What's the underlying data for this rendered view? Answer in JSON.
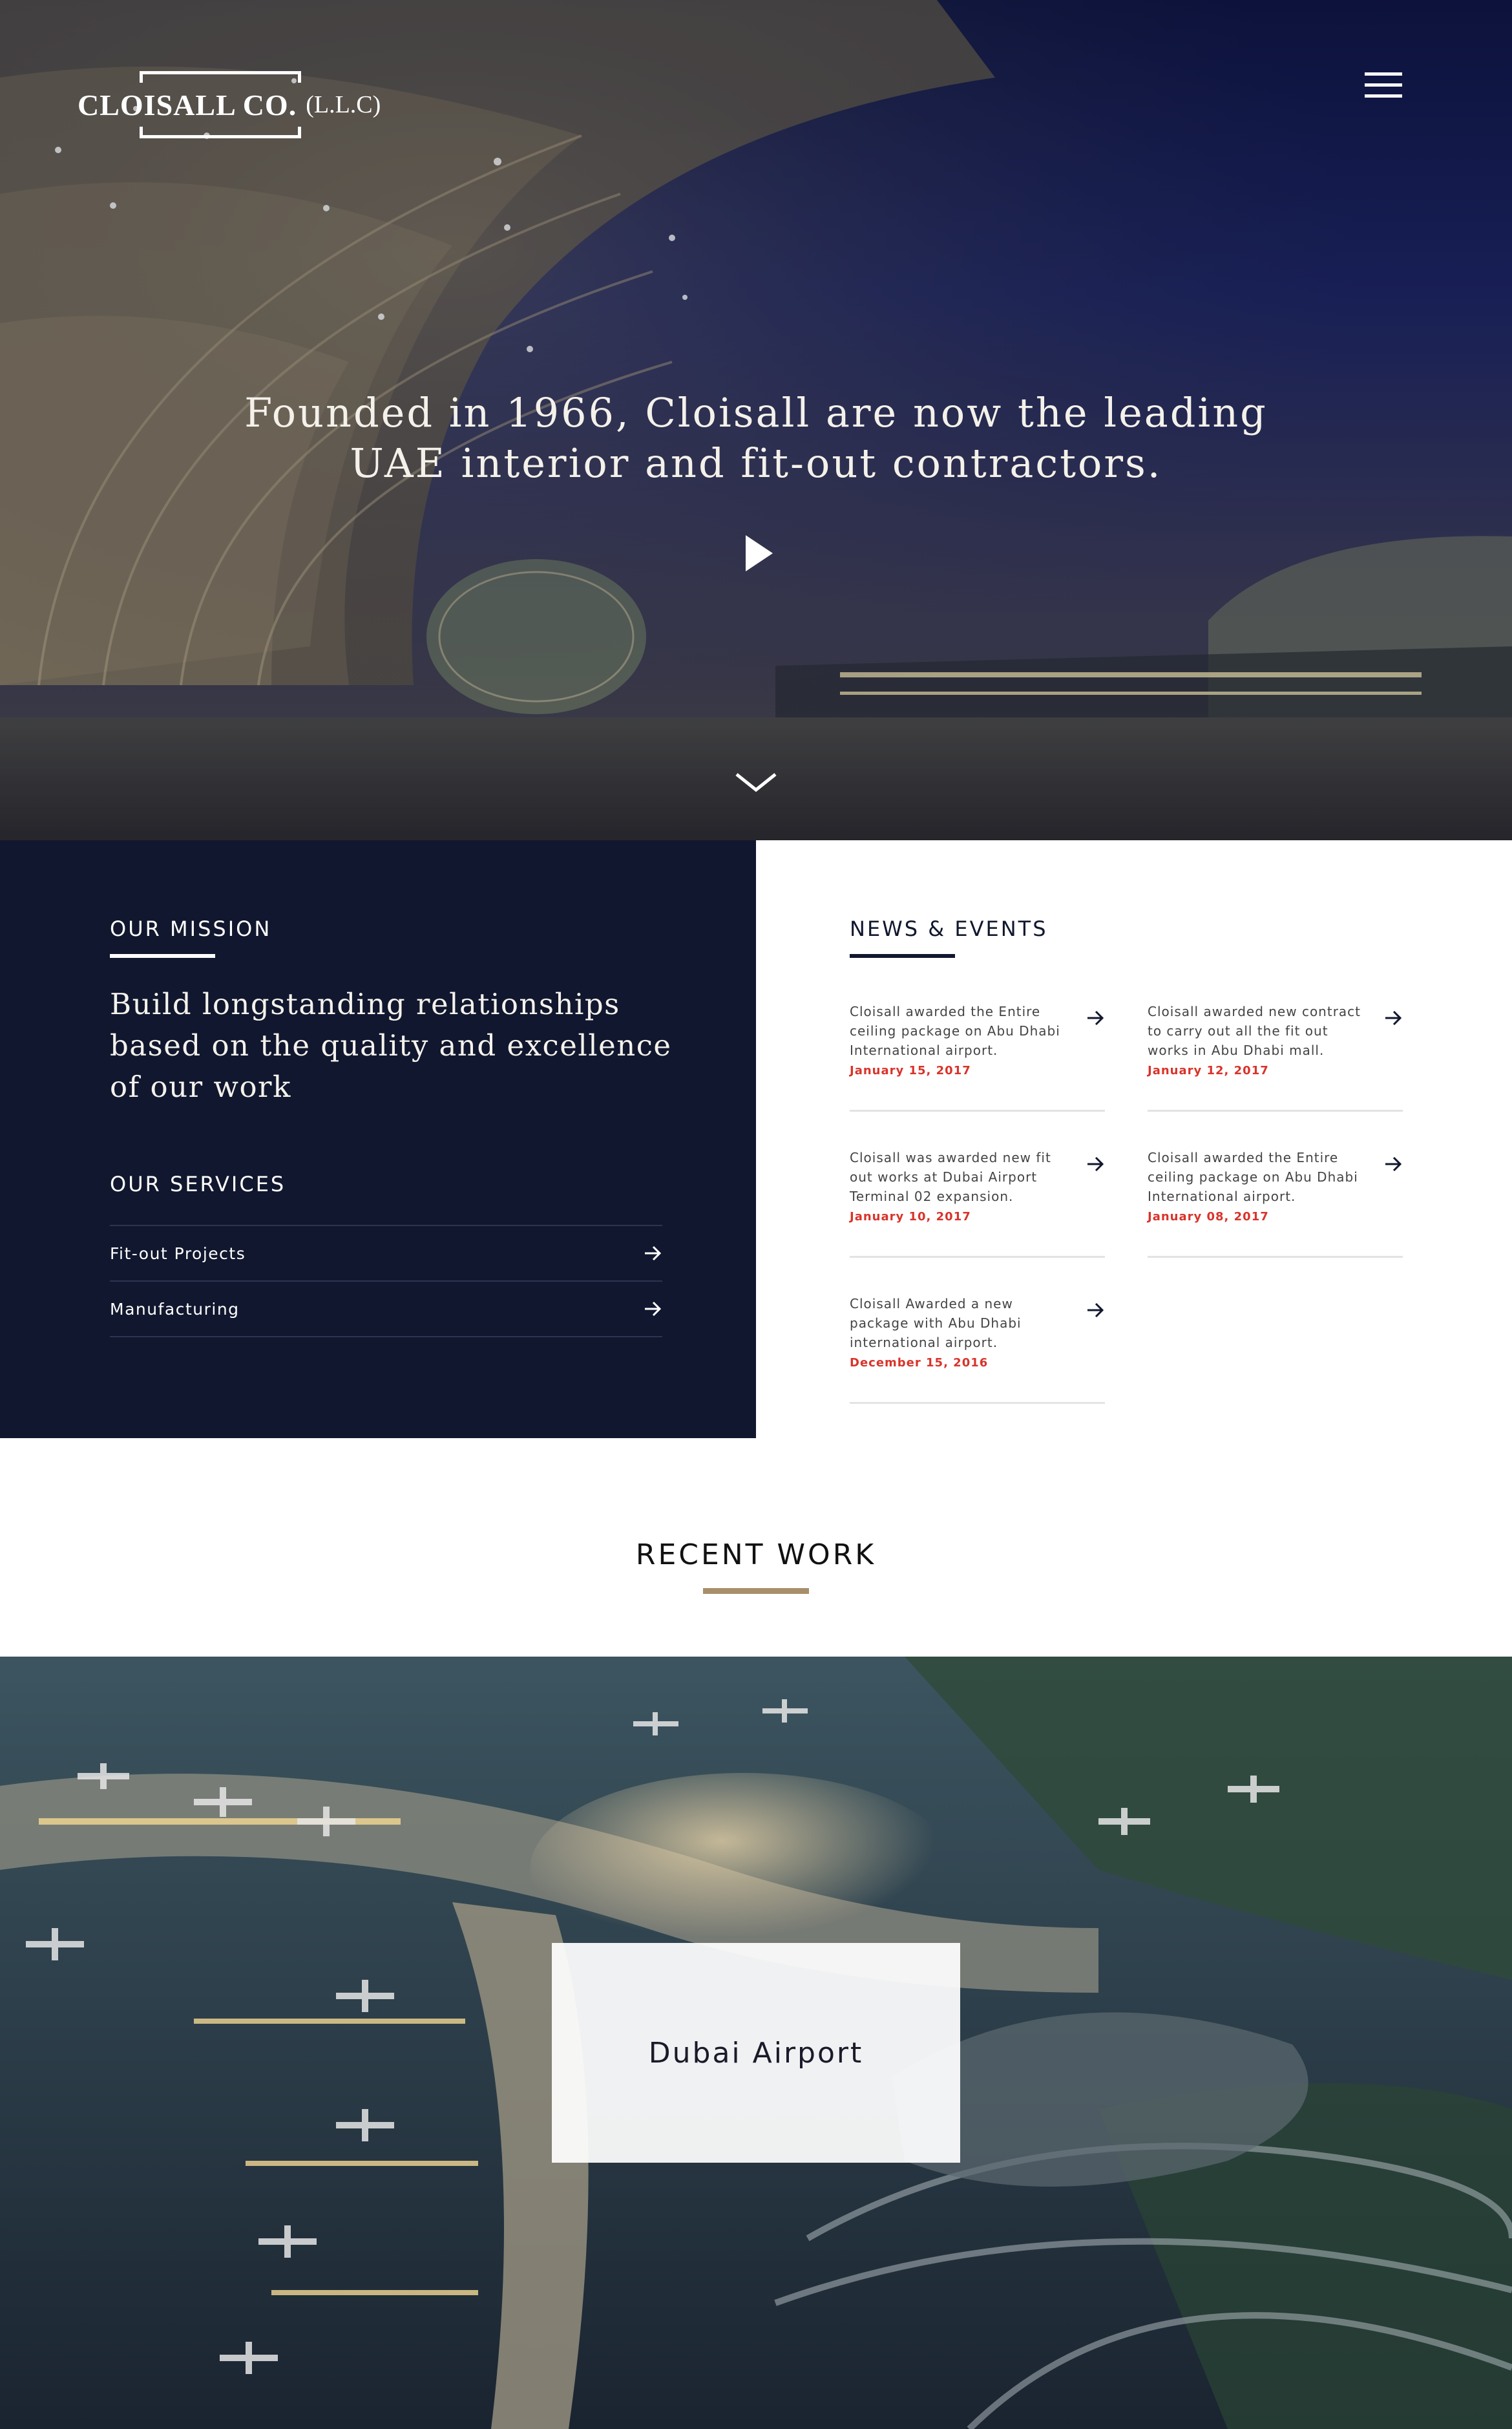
{
  "logo": {
    "main": "CLOISALL CO.",
    "sub": "(L.L.C)"
  },
  "hero": {
    "line1": "Founded in 1966, Cloisall are now the leading",
    "line2": "UAE interior and fit-out contractors."
  },
  "mission": {
    "heading": "OUR MISSION",
    "text_line1": "Build longstanding relationships",
    "text_line2": "based on the quality and excellence",
    "text_line3": "of our work",
    "services_heading": "OUR SERVICES",
    "services": [
      {
        "label": "Fit-out Projects"
      },
      {
        "label": "Manufacturing"
      }
    ]
  },
  "news": {
    "heading": "NEWS & EVENTS",
    "items": [
      {
        "text": "Cloisall awarded the Entire ceiling package on Abu Dhabi International airport.",
        "date": "January 15, 2017"
      },
      {
        "text": "Cloisall awarded new contract to carry out all the fit out works in Abu Dhabi mall.",
        "date": "January 12, 2017"
      },
      {
        "text": "Cloisall was awarded new fit out works at Dubai Airport Terminal 02 expansion.",
        "date": "January 10, 2017"
      },
      {
        "text": "Cloisall awarded the Entire ceiling package on Abu Dhabi International airport.",
        "date": "January 08, 2017"
      },
      {
        "text": "Cloisall Awarded a new package with Abu Dhabi international airport.",
        "date": "December 15, 2016"
      }
    ]
  },
  "recent": {
    "heading": "RECENT WORK",
    "project": "Dubai Airport"
  },
  "colors": {
    "navy": "#11172e",
    "gold": "#a88e6a",
    "news_date": "#d8342b"
  },
  "icons": [
    "menu-icon",
    "play-icon",
    "chevron-down-icon",
    "arrow-right-icon"
  ]
}
